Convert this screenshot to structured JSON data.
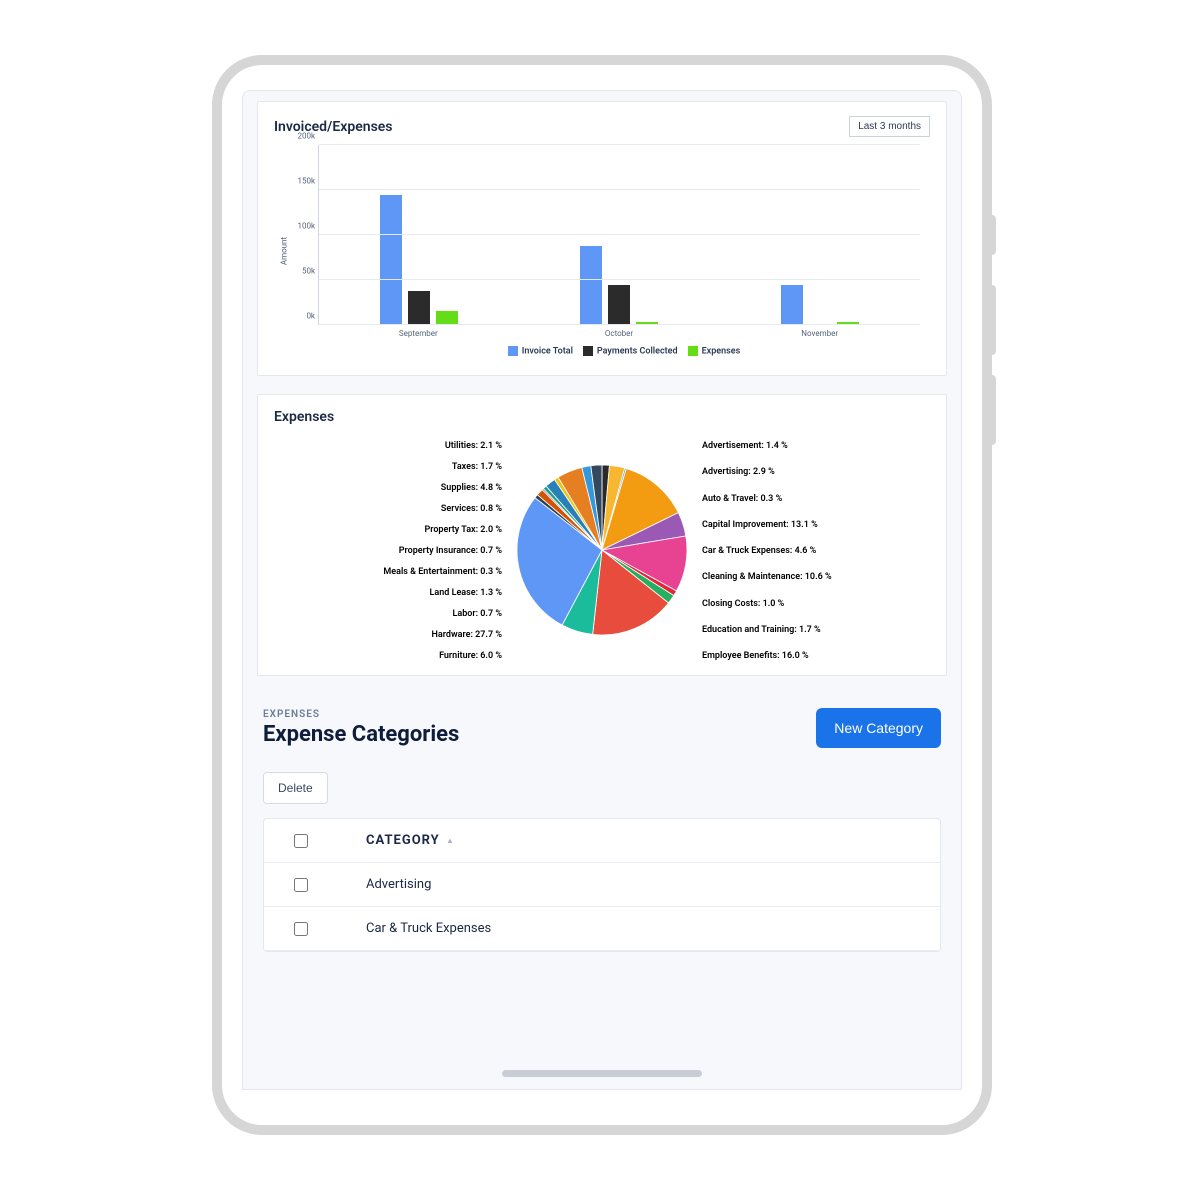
{
  "invoices_card": {
    "title": "Invoiced/Expenses",
    "range_label": "Last 3 months"
  },
  "expenses_card": {
    "title": "Expenses"
  },
  "categories_section": {
    "tag": "EXPENSES",
    "title": "Expense Categories",
    "new_button": "New Category",
    "delete_button": "Delete",
    "header_col": "CATEGORY",
    "rows": [
      "Advertising",
      "Car & Truck Expenses"
    ]
  },
  "colors": {
    "invoice": "#5e97f6",
    "payments": "#2b2b2b",
    "expenses": "#64dd17"
  },
  "chart_data": [
    {
      "type": "bar",
      "title": "Invoiced/Expenses",
      "ylabel": "Amount",
      "xlabel": "",
      "ylim": [
        0,
        200
      ],
      "yformat": "k",
      "yticks": [
        0,
        50,
        100,
        150,
        200
      ],
      "categories": [
        "September",
        "October",
        "November"
      ],
      "series": [
        {
          "name": "Invoice Total",
          "values": [
            145,
            88,
            45
          ],
          "color": "#5e97f6"
        },
        {
          "name": "Payments Collected",
          "values": [
            38,
            44,
            0
          ],
          "color": "#2b2b2b"
        },
        {
          "name": "Expenses",
          "values": [
            16,
            3,
            3
          ],
          "color": "#64dd17"
        }
      ]
    },
    {
      "type": "pie",
      "title": "Expenses",
      "series": [
        {
          "name": "Advertisement",
          "value": 1.4,
          "color": "#2a2a2a"
        },
        {
          "name": "Advertising",
          "value": 2.9,
          "color": "#f7b731"
        },
        {
          "name": "Auto & Travel",
          "value": 0.3,
          "color": "#2d98da"
        },
        {
          "name": "Capital Improvement",
          "value": 13.1,
          "color": "#f39c12"
        },
        {
          "name": "Car & Truck Expenses",
          "value": 4.6,
          "color": "#9b59b6"
        },
        {
          "name": "Cleaning & Maintenance",
          "value": 10.6,
          "color": "#e84393"
        },
        {
          "name": "Closing Costs",
          "value": 1.0,
          "color": "#e5243b"
        },
        {
          "name": "Education and Training",
          "value": 1.7,
          "color": "#27ae60"
        },
        {
          "name": "Employee Benefits",
          "value": 16.0,
          "color": "#e74c3c"
        },
        {
          "name": "Furniture",
          "value": 6.0,
          "color": "#1abc9c"
        },
        {
          "name": "Hardware",
          "value": 27.7,
          "color": "#5e97f6"
        },
        {
          "name": "Labor",
          "value": 0.7,
          "color": "#2c3e50"
        },
        {
          "name": "Land Lease",
          "value": 1.3,
          "color": "#d35400"
        },
        {
          "name": "Meals & Entertainment",
          "value": 0.3,
          "color": "#8e44ad"
        },
        {
          "name": "Property Insurance",
          "value": 0.7,
          "color": "#16a085"
        },
        {
          "name": "Property Tax",
          "value": 2.0,
          "color": "#2980b9"
        },
        {
          "name": "Services",
          "value": 0.8,
          "color": "#f1c40f"
        },
        {
          "name": "Supplies",
          "value": 4.8,
          "color": "#e67e22"
        },
        {
          "name": "Taxes",
          "value": 1.7,
          "color": "#3498db"
        },
        {
          "name": "Utilities",
          "value": 2.1,
          "color": "#34495e"
        }
      ]
    }
  ]
}
